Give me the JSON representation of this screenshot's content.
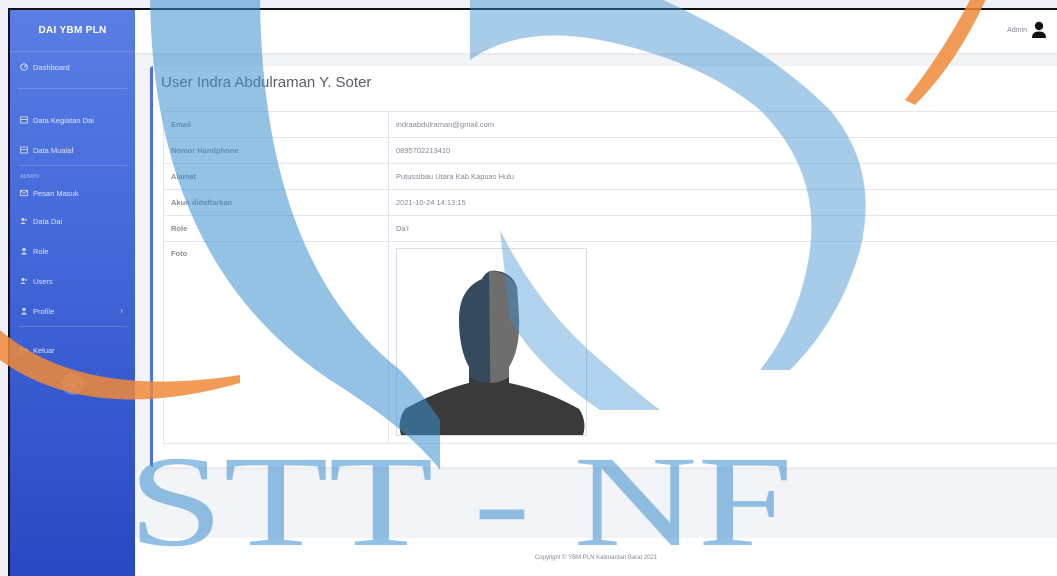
{
  "sidebar": {
    "brand": "DAI YBM PLN",
    "items": [
      {
        "label": "Dashboard",
        "icon": "tachometer-icon"
      },
      {
        "label": "Data Kegiatan Dai",
        "icon": "table-icon"
      },
      {
        "label": "Data Mualaf",
        "icon": "table-icon"
      }
    ],
    "admin_heading": "ADMIN",
    "admin_items": [
      {
        "label": "Pesan Masuk",
        "icon": "envelope-icon"
      },
      {
        "label": "Data Dai",
        "icon": "users-icon"
      },
      {
        "label": "Role",
        "icon": "user-icon"
      },
      {
        "label": "Users",
        "icon": "users-icon"
      },
      {
        "label": "Profile",
        "icon": "user-icon"
      }
    ],
    "logout": "Keluar",
    "toggle": "‹"
  },
  "topbar": {
    "username": "Admin"
  },
  "card": {
    "title": "User Indra Abdulraman Y. Soter",
    "rows": [
      {
        "key": "Email",
        "value": "indraabdulraman@gmail.com"
      },
      {
        "key": "Nomor Handphone",
        "value": "0895702213410"
      },
      {
        "key": "Alamat",
        "value": "Putussibau Utara Kab Kapuas Hulu"
      },
      {
        "key": "Akun didaftarkan",
        "value": "2021-10-24 14:13:15"
      },
      {
        "key": "Role",
        "value": "Da'i"
      },
      {
        "key": "Foto",
        "value": ""
      }
    ]
  },
  "footer": "Copyright © YBM PLN Kalimantan Barat 2021",
  "watermark": "STT - NF",
  "colors": {
    "primary": "#4e73df",
    "watermark_blue": "#3c8fd0",
    "watermark_orange": "#f08a3a"
  }
}
